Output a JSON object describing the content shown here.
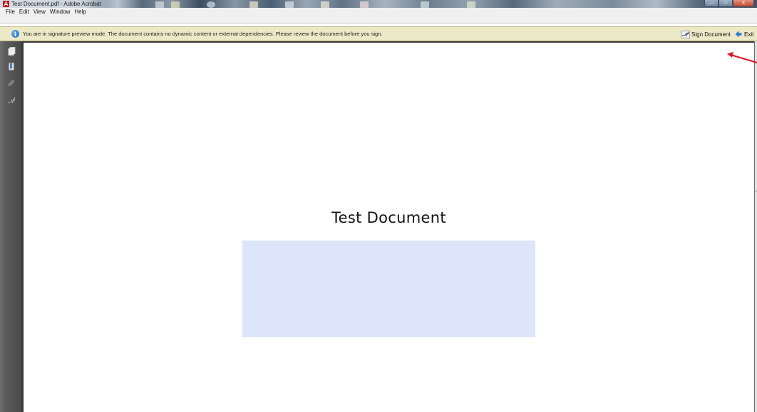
{
  "window": {
    "title": "Test Document.pdf - Adobe Acrobat",
    "controls": {
      "minimize": "—",
      "maximize": "□",
      "close": "X"
    }
  },
  "menubar": {
    "items": [
      "File",
      "Edit",
      "View",
      "Window",
      "Help"
    ]
  },
  "infobar": {
    "icon": "info-icon",
    "message": "You are in signature preview mode. The document contains no dynamic content or external dependencies. Please review the document before you sign.",
    "sign_label": "Sign Document",
    "exit_label": "Exit"
  },
  "navpane": {
    "icons": [
      "pages-icon",
      "bookmark-icon",
      "attachment-icon",
      "signatures-icon"
    ]
  },
  "document": {
    "title": "Test Document"
  },
  "colors": {
    "infobar_bg": "#ece9c6",
    "signature_field": "#dde5fb",
    "annotation_arrow": "#e0141e"
  }
}
